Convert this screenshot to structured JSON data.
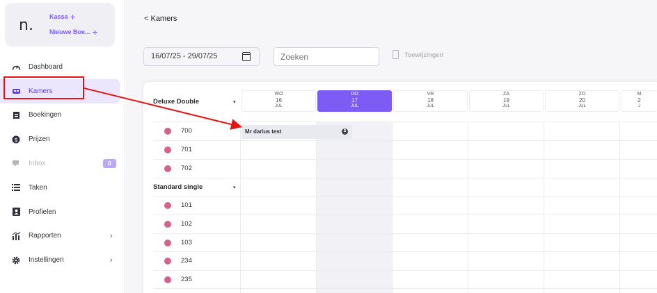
{
  "sidebar": {
    "logo_text": "n.",
    "quick_actions": [
      {
        "label": "Kassa",
        "icon": "plus-icon"
      },
      {
        "label": "Nieuwe Boe...",
        "icon": "plus-icon"
      }
    ],
    "items": [
      {
        "label": "Dashboard",
        "icon": "gauge-icon"
      },
      {
        "label": "Kamers",
        "icon": "bed-icon",
        "active": true
      },
      {
        "label": "Boekingen",
        "icon": "booking-icon"
      },
      {
        "label": "Prijzen",
        "icon": "dollar-icon"
      },
      {
        "label": "Inbox",
        "icon": "chat-icon",
        "badge": "0",
        "disabled": true
      },
      {
        "label": "Taken",
        "icon": "list-icon"
      },
      {
        "label": "Profielen",
        "icon": "profile-icon"
      },
      {
        "label": "Rapporten",
        "icon": "chart-icon",
        "chevron": "›"
      },
      {
        "label": "Instellingen",
        "icon": "gear-icon",
        "chevron": "›"
      }
    ]
  },
  "header": {
    "back_label": "< Kamers",
    "date_range": "16/07/25 - 29/07/25",
    "search_placeholder": "Zoeken",
    "assign_label": "Toewijzingen"
  },
  "calendar": {
    "days": [
      {
        "weekday": "WO",
        "day": "16",
        "month": "JUL"
      },
      {
        "weekday": "DO",
        "day": "17",
        "month": "JUL",
        "today": true
      },
      {
        "weekday": "VR",
        "day": "18",
        "month": "JUL"
      },
      {
        "weekday": "ZA",
        "day": "19",
        "month": "JUL"
      },
      {
        "weekday": "ZO",
        "day": "20",
        "month": "JUL"
      },
      {
        "weekday": "M",
        "day": "2",
        "month": "J"
      }
    ],
    "groups": [
      {
        "name": "Deluxe Double",
        "caret": "▾",
        "rooms": [
          "700",
          "701",
          "702"
        ]
      },
      {
        "name": "Standard single",
        "caret": "▾",
        "rooms": [
          "101",
          "102",
          "103",
          "234",
          "235"
        ]
      }
    ],
    "booking": {
      "guest": "Mr darius test",
      "icon": "dollar-icon",
      "room": "700"
    }
  },
  "colors": {
    "accent": "#7c5cf5",
    "room_dot": "#d4618e",
    "annotation": "#e31414"
  }
}
